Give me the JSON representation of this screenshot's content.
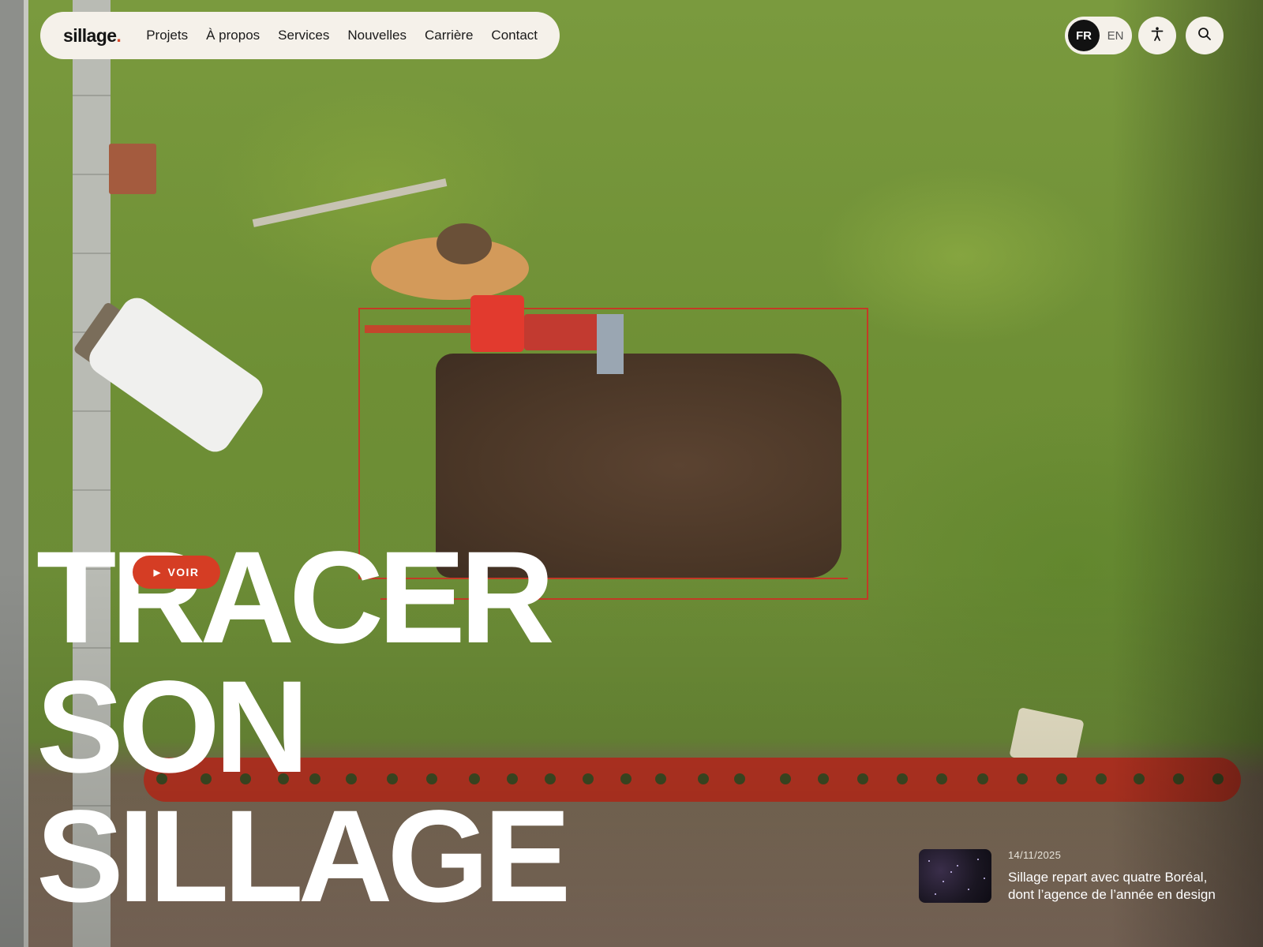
{
  "header": {
    "logo": "sillage",
    "logo_dot": ".",
    "nav": [
      {
        "label": "Projets"
      },
      {
        "label": "À propos"
      },
      {
        "label": "Services"
      },
      {
        "label": "Nouvelles"
      },
      {
        "label": "Carrière"
      },
      {
        "label": "Contact"
      }
    ],
    "languages": {
      "active": "FR",
      "other": "EN"
    },
    "icons": {
      "accessibility": "accessibility-icon",
      "search": "search-icon"
    }
  },
  "hero": {
    "headline_lines": [
      "TRACER",
      "SON",
      "SILLAGE"
    ],
    "play_button_label": "VOIR"
  },
  "news": {
    "date": "14/11/2025",
    "title": "Sillage repart avec quatre Boréal, dont l’agence de l’année en design"
  },
  "colors": {
    "accent": "#d53d24",
    "nav_bg": "#f5f1ea",
    "text_dark": "#141414"
  }
}
